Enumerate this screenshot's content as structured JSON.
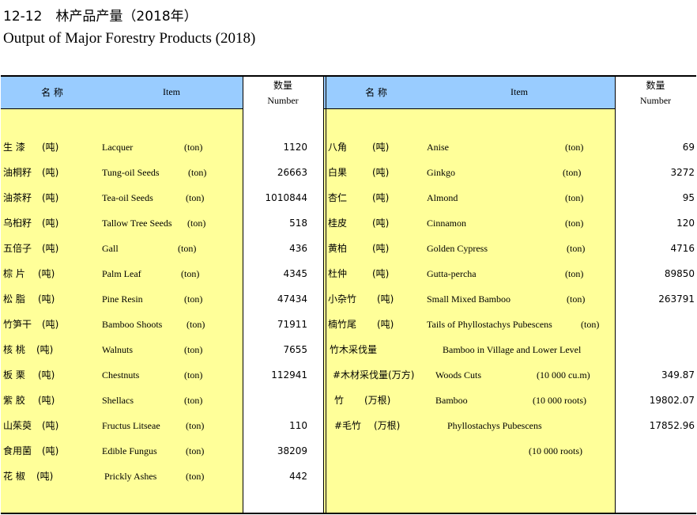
{
  "title": {
    "cn": "12-12　林产品产量（2018年）",
    "en": "Output of Major Forestry Products (2018)"
  },
  "headers": {
    "left": {
      "name_cn": "名  称",
      "item_en": "Item",
      "number_cn": "数量",
      "number_en": "Number"
    },
    "right": {
      "name_cn": "名  称",
      "item_en": "Item",
      "number_cn": "数量",
      "number_en": "Number"
    }
  },
  "left_rows": [
    {
      "cn": "生  漆",
      "cn_unit": "(吨)",
      "en": "Lacquer",
      "en_unit": "(ton)",
      "value": "1120"
    },
    {
      "cn": "油桐籽",
      "cn_unit": "(吨)",
      "en": "Tung-oil Seeds",
      "en_unit": "(ton)",
      "value": "26663"
    },
    {
      "cn": "油茶籽",
      "cn_unit": "(吨)",
      "en": "Tea-oil Seeds",
      "en_unit": "(ton)",
      "value": "1010844"
    },
    {
      "cn": "乌桕籽",
      "cn_unit": "(吨)",
      "en": "Tallow Tree Seeds",
      "en_unit": "(ton)",
      "value": "518"
    },
    {
      "cn": "五倍子",
      "cn_unit": "(吨)",
      "en": "Gall",
      "en_unit": "(ton)",
      "value": "436"
    },
    {
      "cn": "棕  片",
      "cn_unit": "(吨)",
      "en": "Palm Leaf",
      "en_unit": "(ton)",
      "value": "4345"
    },
    {
      "cn": "松  脂",
      "cn_unit": "(吨)",
      "en": "Pine Resin",
      "en_unit": "(ton)",
      "value": "47434"
    },
    {
      "cn": "竹笋干",
      "cn_unit": "(吨)",
      "en": "Bamboo Shoots",
      "en_unit": "(ton)",
      "value": "71911"
    },
    {
      "cn": "核  桃",
      "cn_unit": "(吨)",
      "en": "Walnuts",
      "en_unit": "(ton)",
      "value": "7655"
    },
    {
      "cn": "板  栗",
      "cn_unit": "(吨)",
      "en": "Chestnuts",
      "en_unit": "(ton)",
      "value": "112941"
    },
    {
      "cn": "紫  胶",
      "cn_unit": "(吨)",
      "en": "Shellacs",
      "en_unit": "(ton)",
      "value": ""
    },
    {
      "cn": "山茱萸",
      "cn_unit": "(吨)",
      "en": "Fructus Litseae",
      "en_unit": "(ton)",
      "value": "110"
    },
    {
      "cn": "食用菌",
      "cn_unit": "(吨)",
      "en": "Edible Fungus",
      "en_unit": "(ton)",
      "value": "38209"
    },
    {
      "cn": "花  椒",
      "cn_unit": "(吨)",
      "en": "Prickly Ashes",
      "en_unit": "(ton)",
      "value": "442"
    }
  ],
  "right_rows": [
    {
      "cn": "八角",
      "cn_unit": "(吨)",
      "en": "Anise",
      "en_unit": "(ton)",
      "value": "69"
    },
    {
      "cn": "白果",
      "cn_unit": "(吨)",
      "en": "Ginkgo",
      "en_unit": "(ton)",
      "value": "3272"
    },
    {
      "cn": "杏仁",
      "cn_unit": "(吨)",
      "en": "Almond",
      "en_unit": "(ton)",
      "value": "95"
    },
    {
      "cn": "桂皮",
      "cn_unit": "(吨)",
      "en": "Cinnamon",
      "en_unit": "(ton)",
      "value": "120"
    },
    {
      "cn": "黄柏",
      "cn_unit": "(吨)",
      "en": "Golden Cypress",
      "en_unit": "(ton)",
      "value": "4716"
    },
    {
      "cn": "杜仲",
      "cn_unit": "(吨)",
      "en": "Gutta-percha",
      "en_unit": "(ton)",
      "value": "89850"
    },
    {
      "cn": "小杂竹",
      "cn_unit": "(吨)",
      "en": "Small Mixed Bamboo",
      "en_unit": "(ton)",
      "value": "263791"
    },
    {
      "cn": "楠竹尾",
      "cn_unit": "(吨)",
      "en": "Tails of Phyllostachys Pubescens",
      "en_unit": "(ton)",
      "value": ""
    },
    {
      "cn": "竹木采伐量",
      "cn_unit": "",
      "en": "Bamboo in Village and Lower Level",
      "en_unit": "",
      "value": ""
    },
    {
      "cn": "#木材采伐量(万方)",
      "cn_unit": "",
      "en": "Woods Cuts",
      "en_unit": "(10 000 cu.m)",
      "value": "349.87"
    },
    {
      "cn": "竹",
      "cn_unit": "(万根)",
      "en": "Bamboo",
      "en_unit": "(10 000 roots)",
      "value": "19802.07"
    },
    {
      "cn": "#毛竹",
      "cn_unit": "(万根)",
      "en": "Phyllostachys Pubescens",
      "en_unit": "",
      "value": "17852.96"
    },
    {
      "cn": "",
      "cn_unit": "",
      "en": "",
      "en_unit": "(10 000 roots)",
      "value": ""
    }
  ]
}
